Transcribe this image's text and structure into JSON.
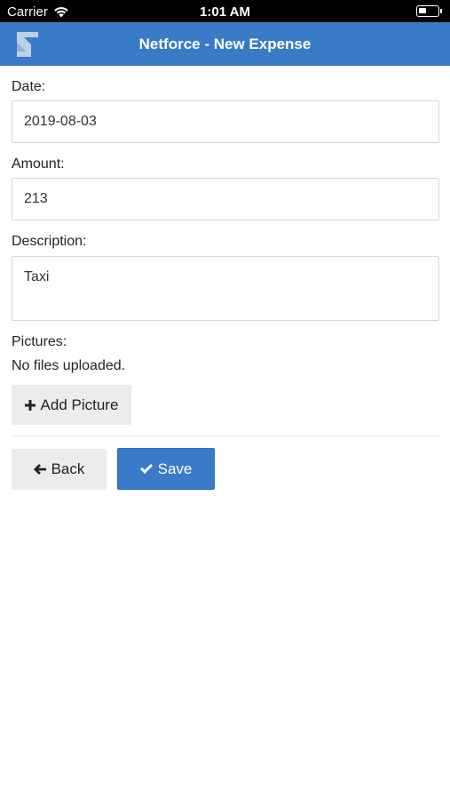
{
  "status_bar": {
    "carrier": "Carrier",
    "time": "1:01 AM"
  },
  "header": {
    "title": "Netforce - New Expense"
  },
  "form": {
    "date": {
      "label": "Date:",
      "value": "2019-08-03"
    },
    "amount": {
      "label": "Amount:",
      "value": "213"
    },
    "description": {
      "label": "Description:",
      "value": "Taxi"
    },
    "pictures": {
      "label": "Pictures:",
      "status": "No files uploaded.",
      "add_label": "Add Picture"
    }
  },
  "actions": {
    "back_label": "Back",
    "save_label": "Save"
  },
  "colors": {
    "accent": "#3a7bc8",
    "button_light": "#ececec"
  }
}
